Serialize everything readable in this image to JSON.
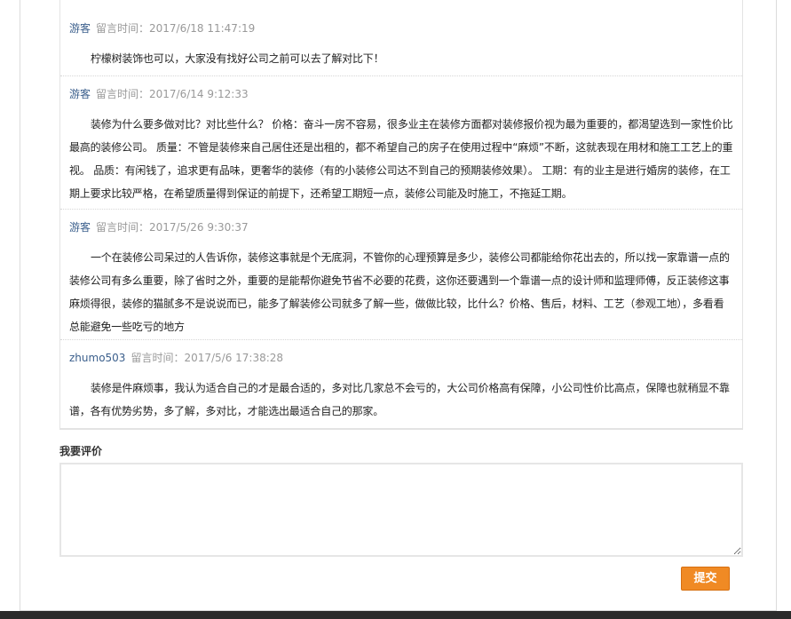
{
  "comments": [
    {
      "author": "游客",
      "time": "留言时间：2017/6/18 11:47:19",
      "text": "柠檬树装饰也可以，大家没有找好公司之前可以去了解对比下！"
    },
    {
      "author": "游客",
      "time": "留言时间：2017/6/14 9:12:33",
      "text": "装修为什么要多做对比？对比些什么？ 价格：奋斗一房不容易，很多业主在装修方面都对装修报价视为最为重要的，都渴望选到一家性价比最高的装修公司。 质量：不管是装修来自己居住还是出租的，都不希望自己的房子在使用过程中“麻烦”不断，这就表现在用材和施工工艺上的重视。 品质：有闲钱了，追求更有品味，更奢华的装修（有的小装修公司达不到自己的预期装修效果）。 工期：有的业主是进行婚房的装修，在工期上要求比较严格，在希望质量得到保证的前提下，还希望工期短一点，装修公司能及时施工，不拖延工期。"
    },
    {
      "author": "游客",
      "time": "留言时间：2017/5/26 9:30:37",
      "text": "一个在装修公司呆过的人告诉你，装修这事就是个无底洞，不管你的心理预算是多少，装修公司都能给你花出去的，所以找一家靠谱一点的装修公司有多么重要，除了省时之外，重要的是能帮你避免节省不必要的花费，这你还要遇到一个靠谱一点的设计师和监理师傅，反正装修这事麻烦得很，装修的猫腻多不是说说而已，能多了解装修公司就多了解一些，做做比较，比什么？价格、售后，材料、工艺（参观工地），多看看总能避免一些吃亏的地方"
    },
    {
      "author": "zhumo503",
      "time": "留言时间：2017/5/6 17:38:28",
      "text": "装修是件麻烦事，我认为适合自己的才是最合适的，多对比几家总不会亏的，大公司价格高有保障，小公司性价比高点，保障也就稍显不靠谱，各有优势劣势，多了解，多对比，才能选出最适合自己的那家。"
    }
  ],
  "review": {
    "label": "我要评价",
    "value": "",
    "submit_label": "提交"
  }
}
